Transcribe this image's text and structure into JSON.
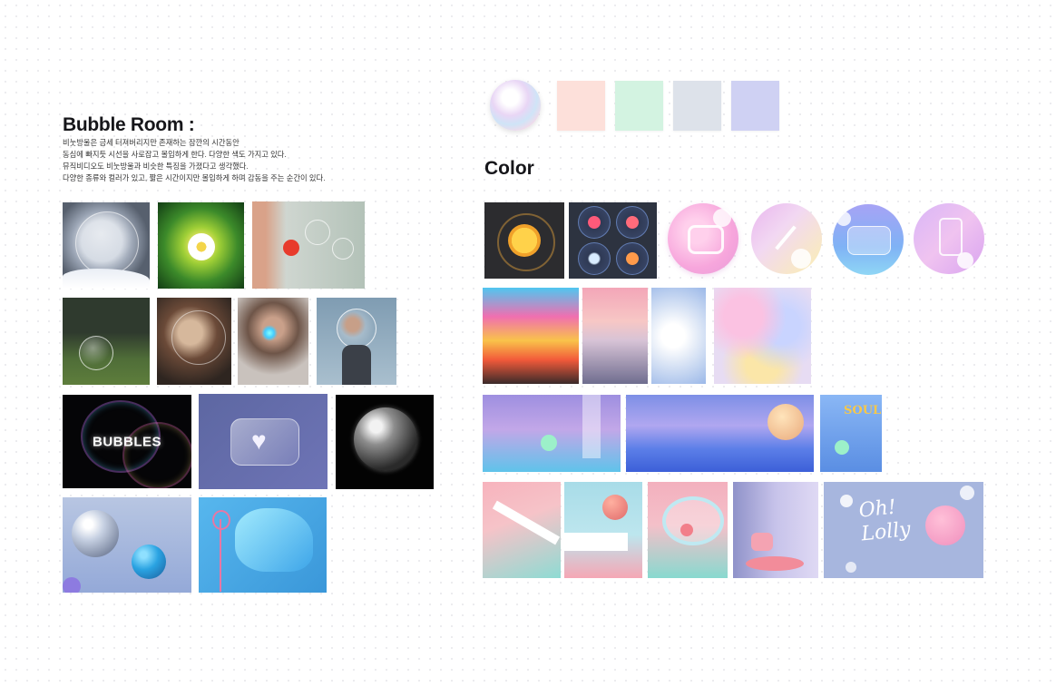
{
  "moodboard": {
    "title": "Bubble Room :",
    "description": [
      "비눗방울은 금세 터져버리지만 존재하는 잠깐의 시간동안",
      "동심에 빠지듯 시선을 사로잡고 몰입하게 한다. 다양한 색도 가지고 있다.",
      "뮤직비디오도 비눗방울과 비슷한 특징을 가졌다고 생각했다.",
      "다양한 종류와 컬러가 있고, 짧은 시간이지만 몰입하게 하며 감동을 주는 순간이 있다."
    ],
    "bubbles_tile_text": "BUBBLES"
  },
  "color_section": {
    "title": "Color",
    "swatches": [
      "#fde0da",
      "#d3f3e1",
      "#dde2ea",
      "#cfd1f3"
    ]
  },
  "icons": [
    "orange-slice-icon",
    "heart-icon",
    "shield-icon",
    "snowflake-icon",
    "flower-icon",
    "camera-icon",
    "pencil-icon",
    "chat-icon",
    "phone-icon"
  ],
  "artwork": {
    "soul_poster_text": "SOUL",
    "lolly_text": "Oh! Lolly"
  }
}
